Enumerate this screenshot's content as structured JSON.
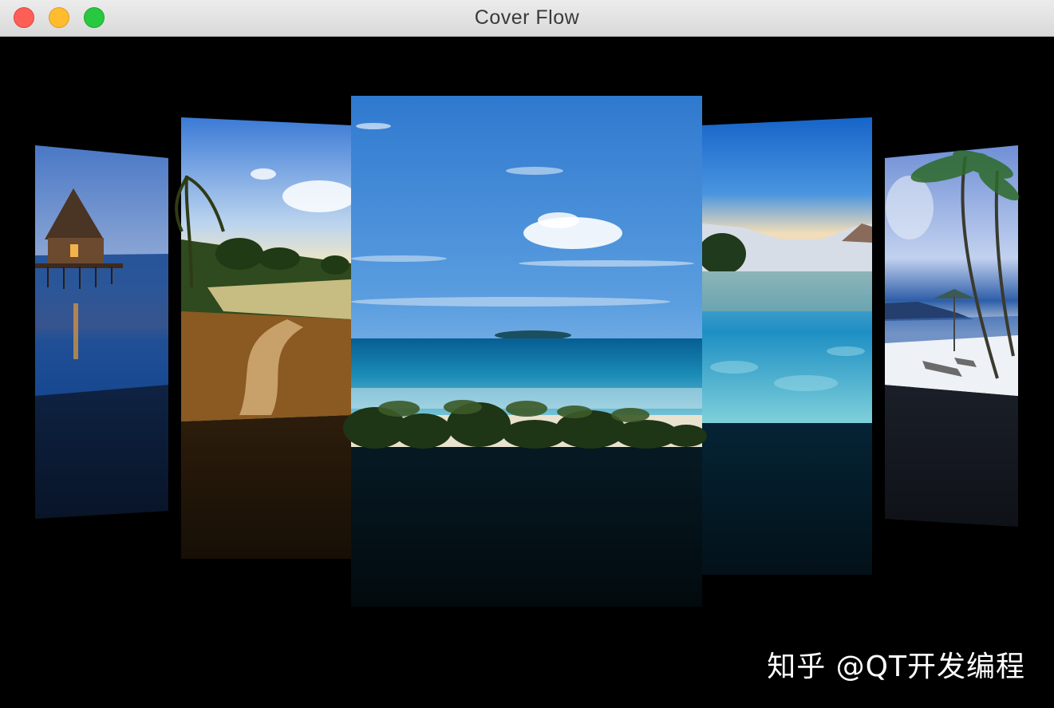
{
  "window": {
    "title": "Cover Flow",
    "traffic_lights": [
      "close",
      "minimize",
      "zoom"
    ]
  },
  "coverflow": {
    "covers": [
      {
        "name": "cover-overwater-bungalow",
        "scene": "overwater bungalow at sunset"
      },
      {
        "name": "cover-tropical-path",
        "scene": "tropical path with palms"
      },
      {
        "name": "cover-ocean-beach",
        "scene": "ocean beach with palm trees",
        "selected": true
      },
      {
        "name": "cover-mountain-lake",
        "scene": "clear lake with mountains"
      },
      {
        "name": "cover-palm-beach",
        "scene": "palm beach with umbrellas"
      }
    ]
  },
  "watermark": {
    "text": "知乎 @QT开发编程"
  }
}
